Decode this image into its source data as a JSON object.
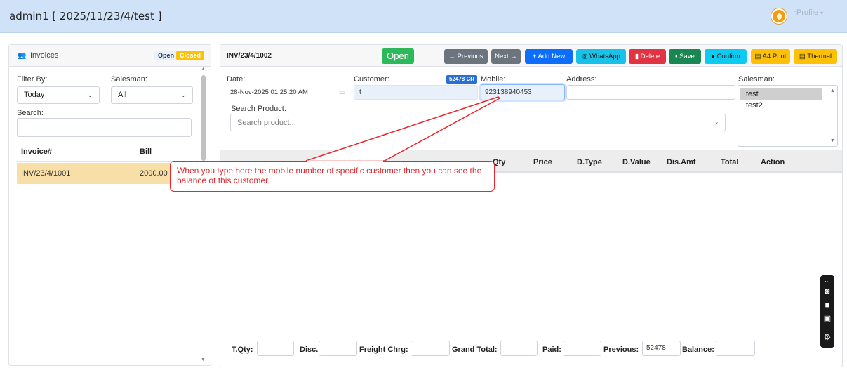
{
  "header": {
    "title": "admin1 [ 2025/11/23/4/test ]",
    "profile_label": "Profile",
    "caret": "▾"
  },
  "left": {
    "title": "Invoices",
    "badge_open": "Open",
    "badge_closed": "Closed",
    "filter_label": "Filter By:",
    "filter_value": "Today",
    "salesman_label": "Salesman:",
    "salesman_value": "All",
    "search_label": "Search:",
    "search_value": "",
    "columns": [
      "Invoice#",
      "Bill"
    ],
    "rows": [
      {
        "invoice": "INV/23/4/1001",
        "bill": "2000.00"
      }
    ]
  },
  "main": {
    "invoice_no": "INV/23/4/1002",
    "status": "Open",
    "buttons": {
      "previous": "← Previous",
      "next": "Next →",
      "add_new": "+ Add New",
      "whatsapp": "WhatsApp",
      "delete": "Delete",
      "save": "Save",
      "confirm": "Confirm",
      "a4_print": "A4 Print",
      "thermal": "Thermal"
    },
    "date_label": "Date:",
    "date_value": "28-Nov-2025 01:25:20 AM",
    "customer_label": "Customer:",
    "customer_value": "t",
    "balance_badge": "52478 CR",
    "mobile_label": "Mobile:",
    "mobile_value": "923138940453",
    "address_label": "Address:",
    "address_value": "",
    "salesman_label": "Salesman:",
    "salesman_options": [
      "test",
      "test2"
    ],
    "search_product_label": "Search Product:",
    "search_product_placeholder": "Search product...",
    "columns": [
      "Qty",
      "Price",
      "D.Type",
      "D.Value",
      "Dis.Amt",
      "Total",
      "Action"
    ],
    "footer": {
      "tqty_label": "T.Qty:",
      "tqty_value": "",
      "disc_label": "Disc.:",
      "disc_value": "",
      "freight_label": "Freight Chrg:",
      "freight_value": "",
      "grand_label": "Grand Total:",
      "grand_value": "",
      "paid_label": "Paid:",
      "paid_value": "",
      "previous_label": "Previous:",
      "previous_value": "52478",
      "balance_label": "Balance:",
      "balance_value": ""
    }
  },
  "callout": {
    "text": "When you type here the mobile number of specific customer then you can see the balance of this customer."
  },
  "colors": {
    "header_bg": "#cfe2f8",
    "open_green": "#2eb85c",
    "selected_row": "#f8dfa8",
    "callout_red": "#e8262b"
  }
}
